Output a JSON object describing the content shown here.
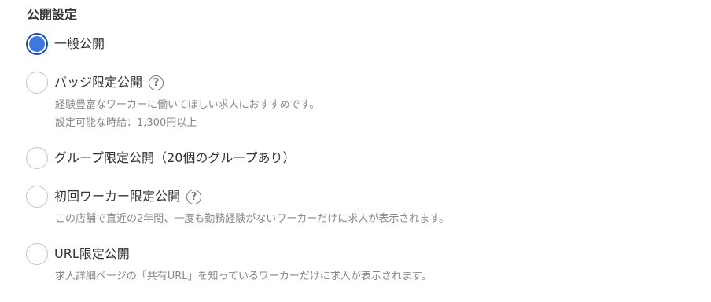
{
  "section": {
    "title": "公開設定"
  },
  "options": [
    {
      "label": "一般公開",
      "selected": true,
      "has_help": false,
      "descriptions": []
    },
    {
      "label": "バッジ限定公開",
      "selected": false,
      "has_help": true,
      "help_icon": "question-circle",
      "help_glyph": "?",
      "descriptions": [
        "経験豊富なワーカーに働いてほしい求人におすすめです。",
        "設定可能な時給：1,300円以上"
      ]
    },
    {
      "label": "グループ限定公開（20個のグループあり）",
      "selected": false,
      "has_help": false,
      "descriptions": []
    },
    {
      "label": "初回ワーカー限定公開",
      "selected": false,
      "has_help": true,
      "help_icon": "question-circle",
      "help_glyph": "?",
      "descriptions": [
        "この店舗で直近の2年間、一度も勤務経験がないワーカーだけに求人が表示されます。"
      ]
    },
    {
      "label": "URL限定公開",
      "selected": false,
      "has_help": false,
      "descriptions": [
        "求人詳細ページの「共有URL」を知っているワーカーだけに求人が表示されます。"
      ]
    }
  ],
  "colors": {
    "radio_selected_fill": "#3c78e0",
    "radio_selected_ring": "#1a4fb4",
    "radio_border": "#c4c4c4",
    "text_primary": "#333333",
    "text_secondary": "#888888"
  }
}
